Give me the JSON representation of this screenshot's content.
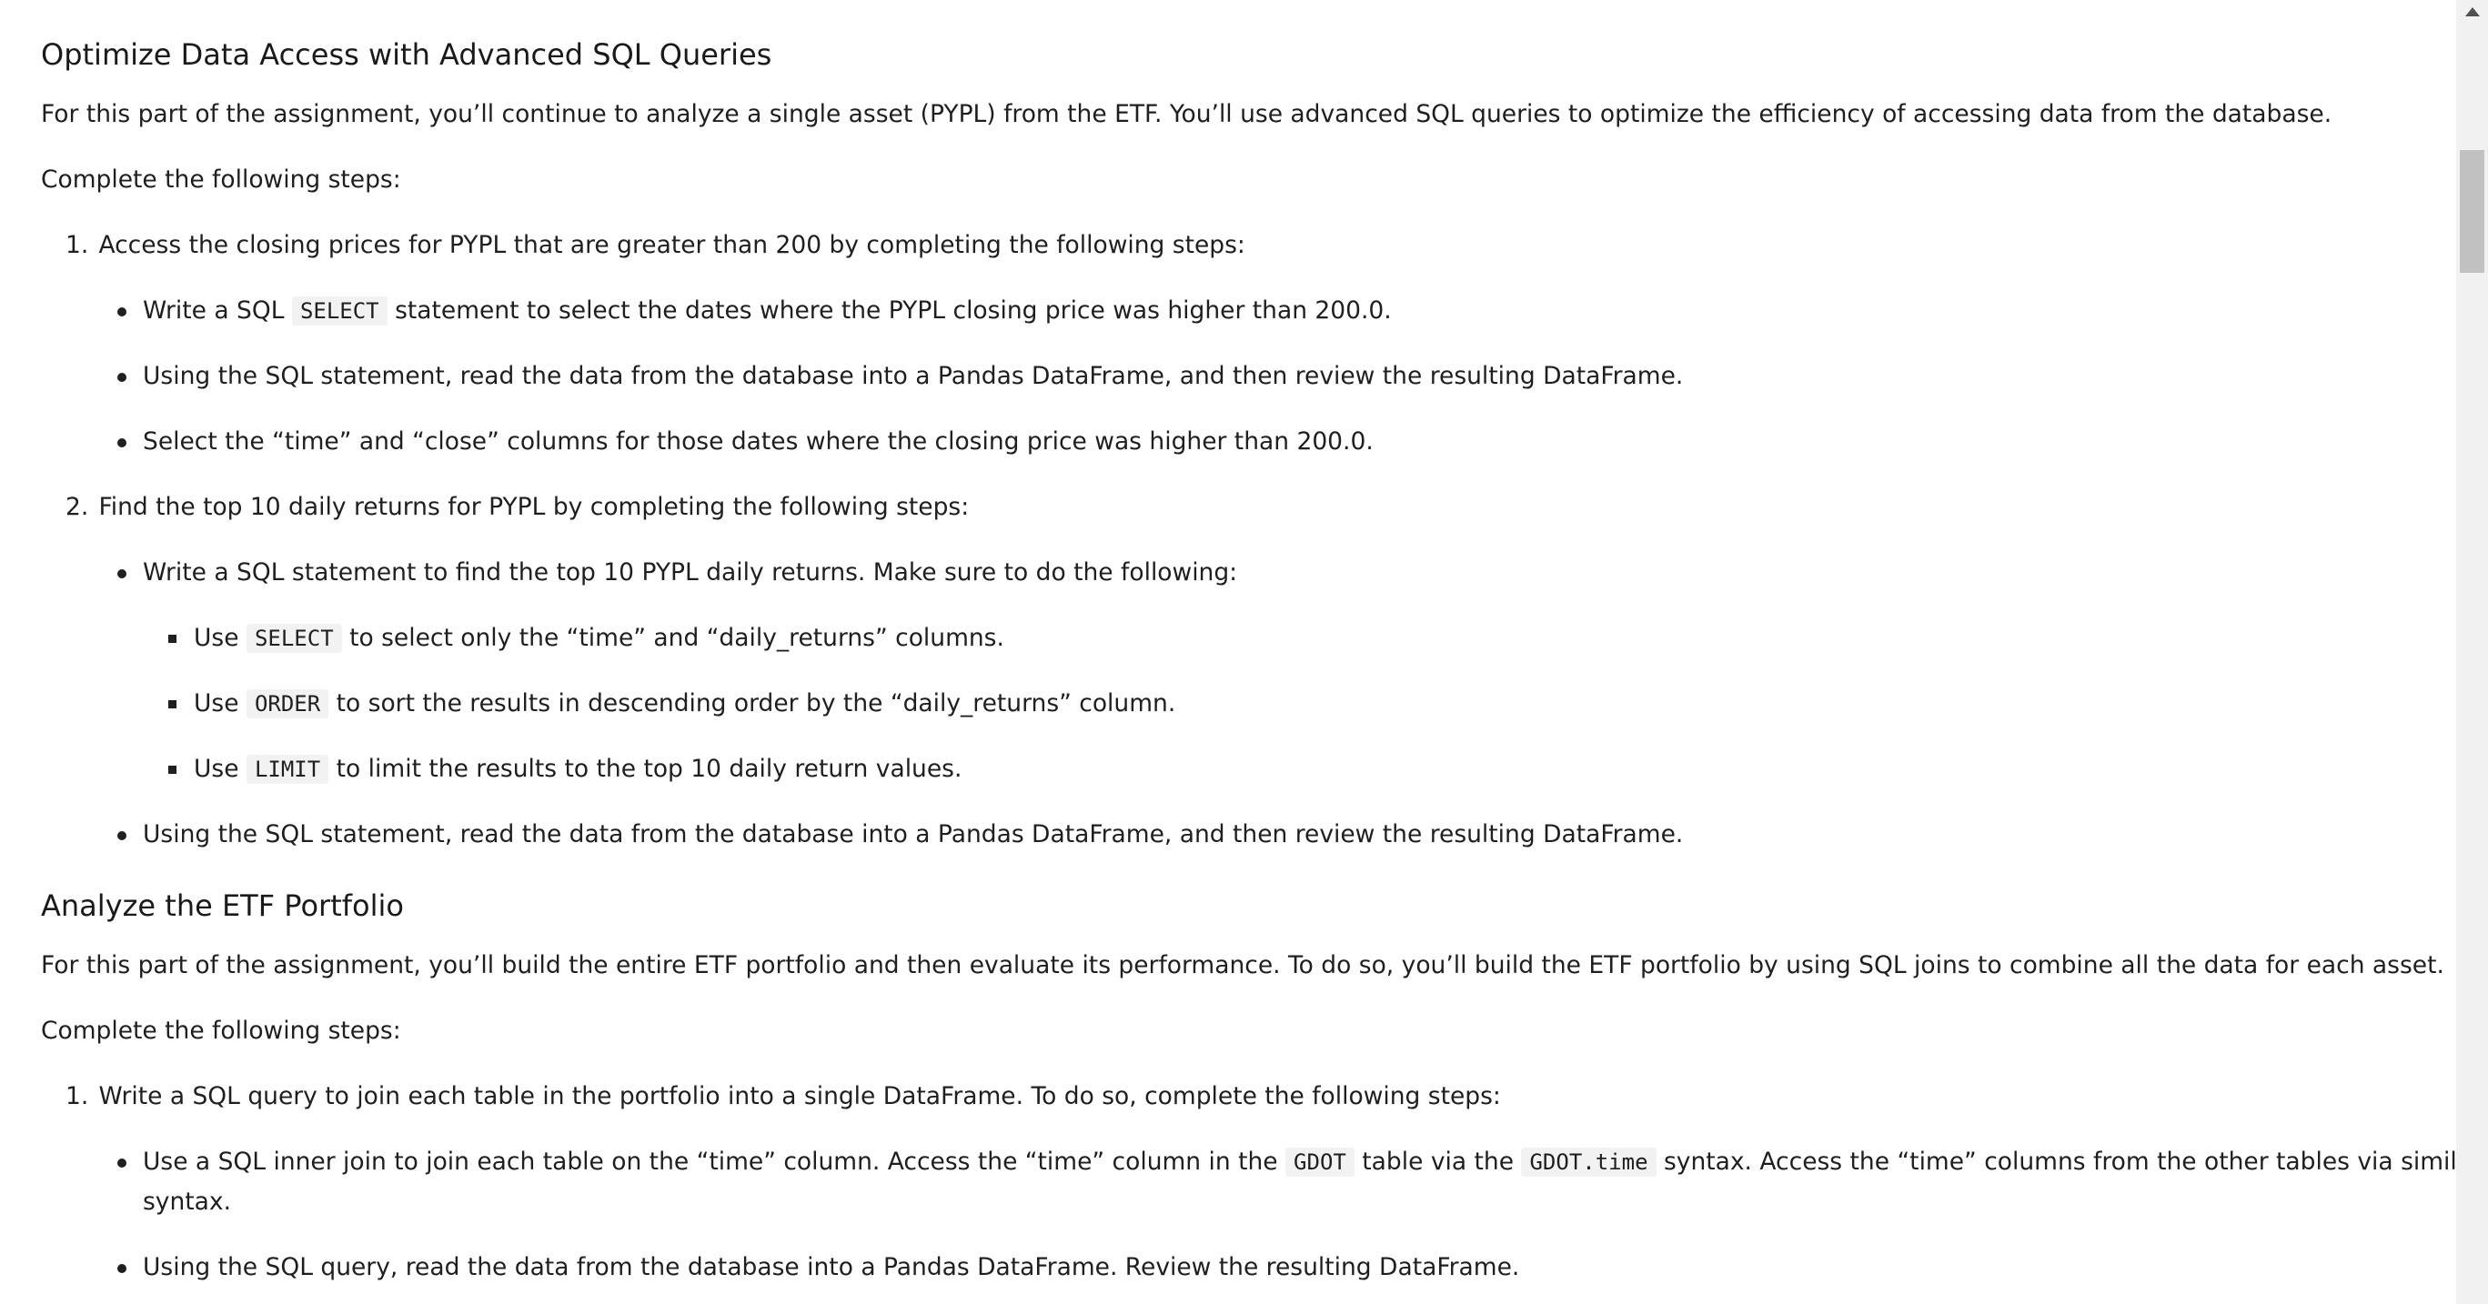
{
  "section1": {
    "title": "Optimize Data Access with Advanced SQL Queries",
    "intro": "For this part of the assignment, you’ll continue to analyze a single asset (PYPL) from the ETF. You’ll use advanced SQL queries to optimize the efficiency of accessing data from the database.",
    "complete": "Complete the following steps:",
    "step1": {
      "num": "1.",
      "text": "Access the closing prices for PYPL that are greater than 200 by completing the following steps:",
      "b1_pre": "Write a SQL",
      "b1_code": "SELECT",
      "b1_post": "statement to select the dates where the PYPL closing price was higher than 200.0.",
      "b2": "Using the SQL statement, read the data from the database into a Pandas DataFrame, and then review the resulting DataFrame.",
      "b3": "Select the “time” and “close” columns for those dates where the closing price was higher than 200.0."
    },
    "step2": {
      "num": "2.",
      "text": "Find the top 10 daily returns for PYPL by completing the following steps:",
      "b1": "Write a SQL statement to find the top 10 PYPL daily returns. Make sure to do the following:",
      "s1_pre": "Use",
      "s1_code": "SELECT",
      "s1_post": "to select only the “time” and “daily_returns” columns.",
      "s2_pre": "Use",
      "s2_code": "ORDER",
      "s2_post": "to sort the results in descending order by the “daily_returns” column.",
      "s3_pre": "Use",
      "s3_code": "LIMIT",
      "s3_post": "to limit the results to the top 10 daily return values.",
      "b2": "Using the SQL statement, read the data from the database into a Pandas DataFrame, and then review the resulting DataFrame."
    }
  },
  "section2": {
    "title": "Analyze the ETF Portfolio",
    "intro": "For this part of the assignment, you’ll build the entire ETF portfolio and then evaluate its performance. To do so, you’ll build the ETF portfolio by using SQL joins to combine all the data for each asset.",
    "complete": "Complete the following steps:",
    "step1": {
      "num": "1.",
      "text": "Write a SQL query to join each table in the portfolio into a single DataFrame. To do so, complete the following steps:",
      "b1_pre": "Use a SQL inner join to join each table on the “time” column. Access the “time” column in the",
      "b1_code1": "GDOT",
      "b1_mid": "table via the",
      "b1_code2": "GDOT.time",
      "b1_post": "syntax. Access the “time” columns from the other tables via similar",
      "b1_wrap": "syntax.",
      "b2": "Using the SQL query, read the data from the database into a Pandas DataFrame. Review the resulting DataFrame."
    }
  }
}
